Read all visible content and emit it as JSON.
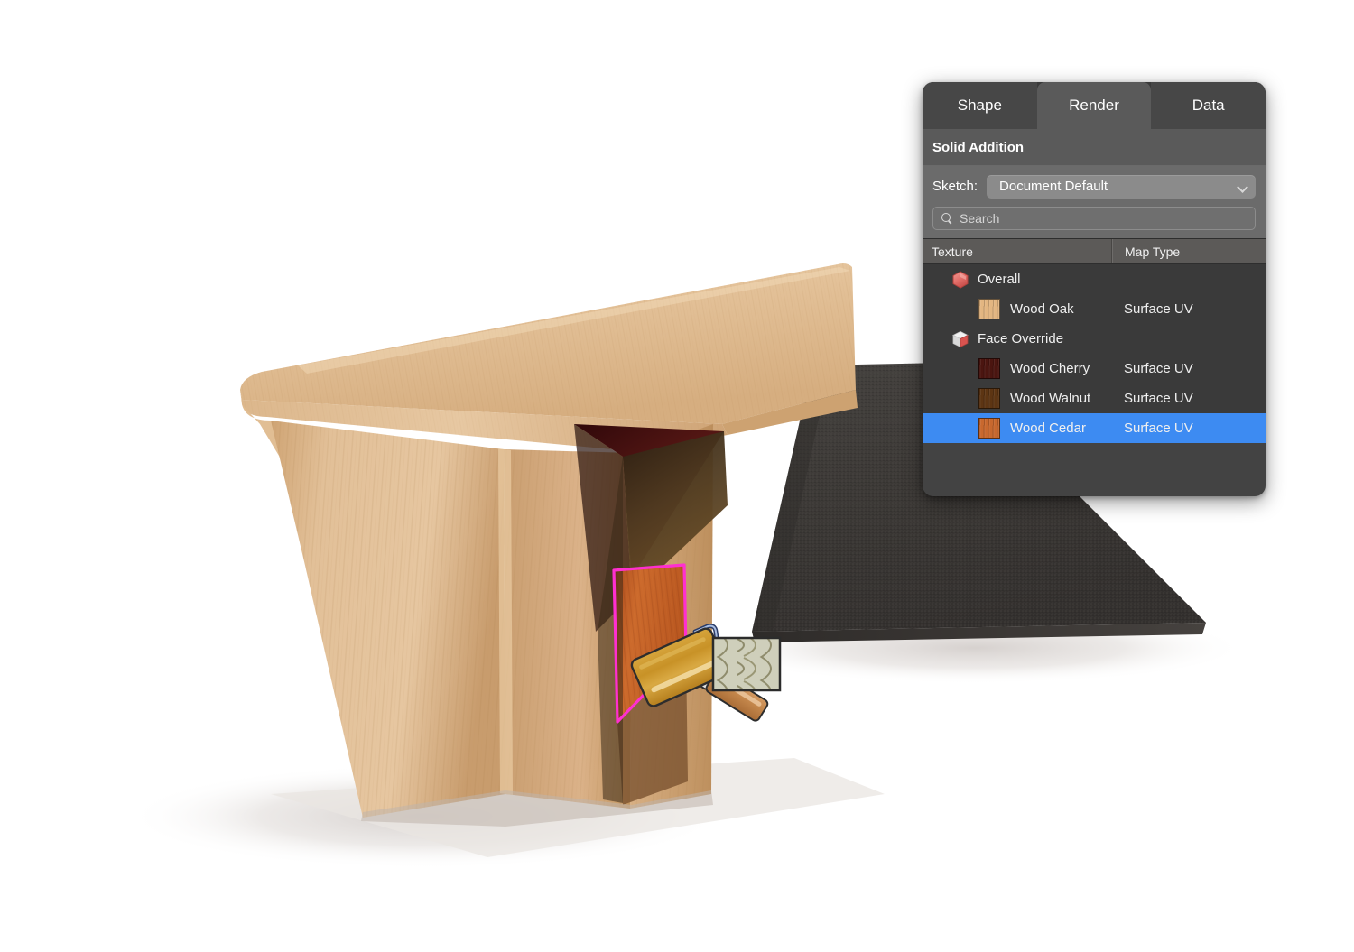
{
  "viewport": {
    "name": "3d-model-viewport",
    "scene_description": "Wooden desk with angled folded-plate leg and dark textured slab leg",
    "materials": {
      "oak_light": "#e2be90",
      "oak_mid": "#d9ae7c",
      "oak_dark": "#c79a67",
      "cedar_face": "#c8682e",
      "cherry_interior": "#4a1510",
      "walnut_interior": "#5a3412",
      "dark_slab": "#3b3937",
      "shadow": "#e6e2e0"
    },
    "selection": {
      "label": "selected-face-outline",
      "color": "#ff2fd0"
    },
    "cursor": {
      "label": "paint-roller-cursor",
      "roller_color": "#c9972f",
      "handle_color": "#c88a4a",
      "frame_color": "#2a3b66",
      "swatch_label": "wood-grain-preview",
      "swatch_bg": "#ccccb8",
      "swatch_grain": "#8d8a6a"
    }
  },
  "panel": {
    "accent_selected": "#3d8bf2",
    "tabs": [
      {
        "label": "Shape",
        "active": false,
        "name": "tab-shape"
      },
      {
        "label": "Render",
        "active": true,
        "name": "tab-render"
      },
      {
        "label": "Data",
        "active": false,
        "name": "tab-data"
      }
    ],
    "section_title": "Solid Addition",
    "sketch": {
      "label": "Sketch:",
      "value": "Document Default"
    },
    "search": {
      "placeholder": "Search",
      "value": ""
    },
    "table": {
      "columns": [
        "Texture",
        "Map Type"
      ],
      "rows": [
        {
          "kind": "group",
          "label": "Overall",
          "icon": "hexagon-sphere-icon",
          "map_type": "",
          "selected": false
        },
        {
          "kind": "texture",
          "label": "Wood Oak",
          "swatch": "#e3b681",
          "map_type": "Surface UV",
          "selected": false
        },
        {
          "kind": "group",
          "label": "Face Override",
          "icon": "cube-face-icon",
          "map_type": "",
          "selected": false
        },
        {
          "kind": "texture",
          "label": "Wood Cherry",
          "swatch": "#4b1510",
          "map_type": "Surface UV",
          "selected": false
        },
        {
          "kind": "texture",
          "label": "Wood Walnut",
          "swatch": "#5d3513",
          "map_type": "Surface UV",
          "selected": false
        },
        {
          "kind": "texture",
          "label": "Wood Cedar",
          "swatch": "#c8682e",
          "map_type": "Surface UV",
          "selected": true
        }
      ]
    }
  }
}
